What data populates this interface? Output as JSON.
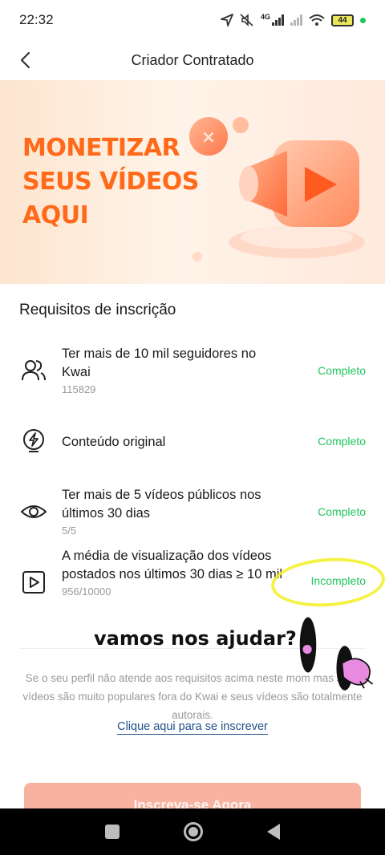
{
  "status_bar": {
    "time": "22:32",
    "network": "4G",
    "battery": "44"
  },
  "header": {
    "title": "Criador Contratado"
  },
  "banner": {
    "line1": "MONETIZAR",
    "line2": "SEUS VÍDEOS",
    "line3": "AQUI"
  },
  "section_title": "Requisitos de inscrição",
  "requirements": [
    {
      "icon": "users-icon",
      "title": "Ter mais de 10 mil seguidores no Kwai",
      "value": "115829",
      "status": "Completo"
    },
    {
      "icon": "bolt-circle-icon",
      "title": "Conteúdo original",
      "value": "",
      "status": "Completo"
    },
    {
      "icon": "eye-icon",
      "title": "Ter mais de 5 vídeos públicos nos últimos 30 dias",
      "value": "5/5",
      "status": "Completo"
    },
    {
      "icon": "play-square-icon",
      "title": "A média de visualização dos vídeos postados nos últimos 30 dias ≥ 10 mil",
      "value": "956/10000",
      "status": "Incompleto"
    }
  ],
  "overlay_text": "vamos nos ajudar?",
  "info_text": "Se o seu perfil não atende aos requisitos acima neste mom mas seus vídeos são muito populares fora do Kwai e seus vídeos são totalmente autorais.",
  "link_text": "Clique aqui para se inscrever",
  "cta_label": "Inscreva-se Agora",
  "colors": {
    "accent": "#ff6a1a",
    "complete": "#22c55e",
    "link": "#1f4f8a",
    "cta": "#f7b2a0"
  }
}
